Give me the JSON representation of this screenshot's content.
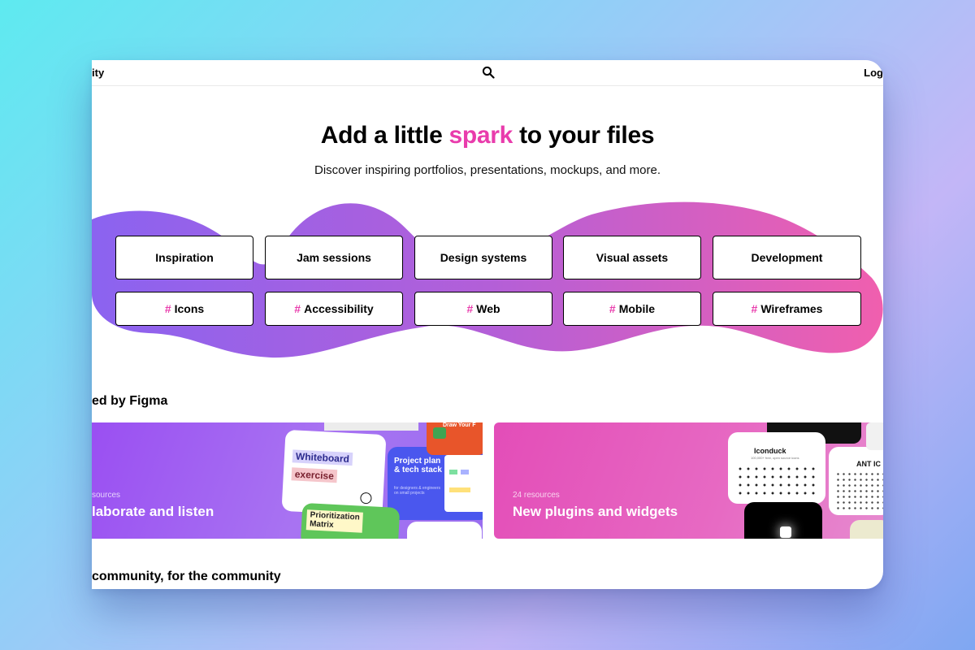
{
  "header": {
    "brand": "ity",
    "login": "Log"
  },
  "hero": {
    "title_before": "Add a little ",
    "title_accent": "spark",
    "title_after": " to your files",
    "subtitle": "Discover inspiring portfolios, presentations, mockups, and more."
  },
  "categories": [
    "Inspiration",
    "Jam sessions",
    "Design systems",
    "Visual assets",
    "Development"
  ],
  "tags": {
    "hash": "#",
    "items": [
      "Icons",
      "Accessibility",
      "Web",
      "Mobile",
      "Wireframes"
    ]
  },
  "curated": {
    "title": "ed by Figma",
    "cards": [
      {
        "count": "sources",
        "title": "laborate and listen",
        "thumbs": {
          "whiteboard_1": "Whiteboard",
          "whiteboard_2": "exercise",
          "project_plan": "Project plan & tech stack",
          "project_sub": "for designers & engineers on small projects",
          "matrix_1": "Prioritization",
          "matrix_2": "Matrix",
          "draw_top": "Draw Your F"
        }
      },
      {
        "count": "24 resources",
        "title": "New plugins and widgets",
        "thumbs": {
          "iconduck": "Iconduck",
          "iconduck_sub": "100,000+ free, open source icons",
          "ant": "ANT IC"
        }
      }
    ]
  },
  "community": {
    "title": "community, for the community"
  },
  "colors": {
    "accent": "#e93cac",
    "blob_start": "#8b63f0",
    "blob_end": "#f05fae"
  }
}
